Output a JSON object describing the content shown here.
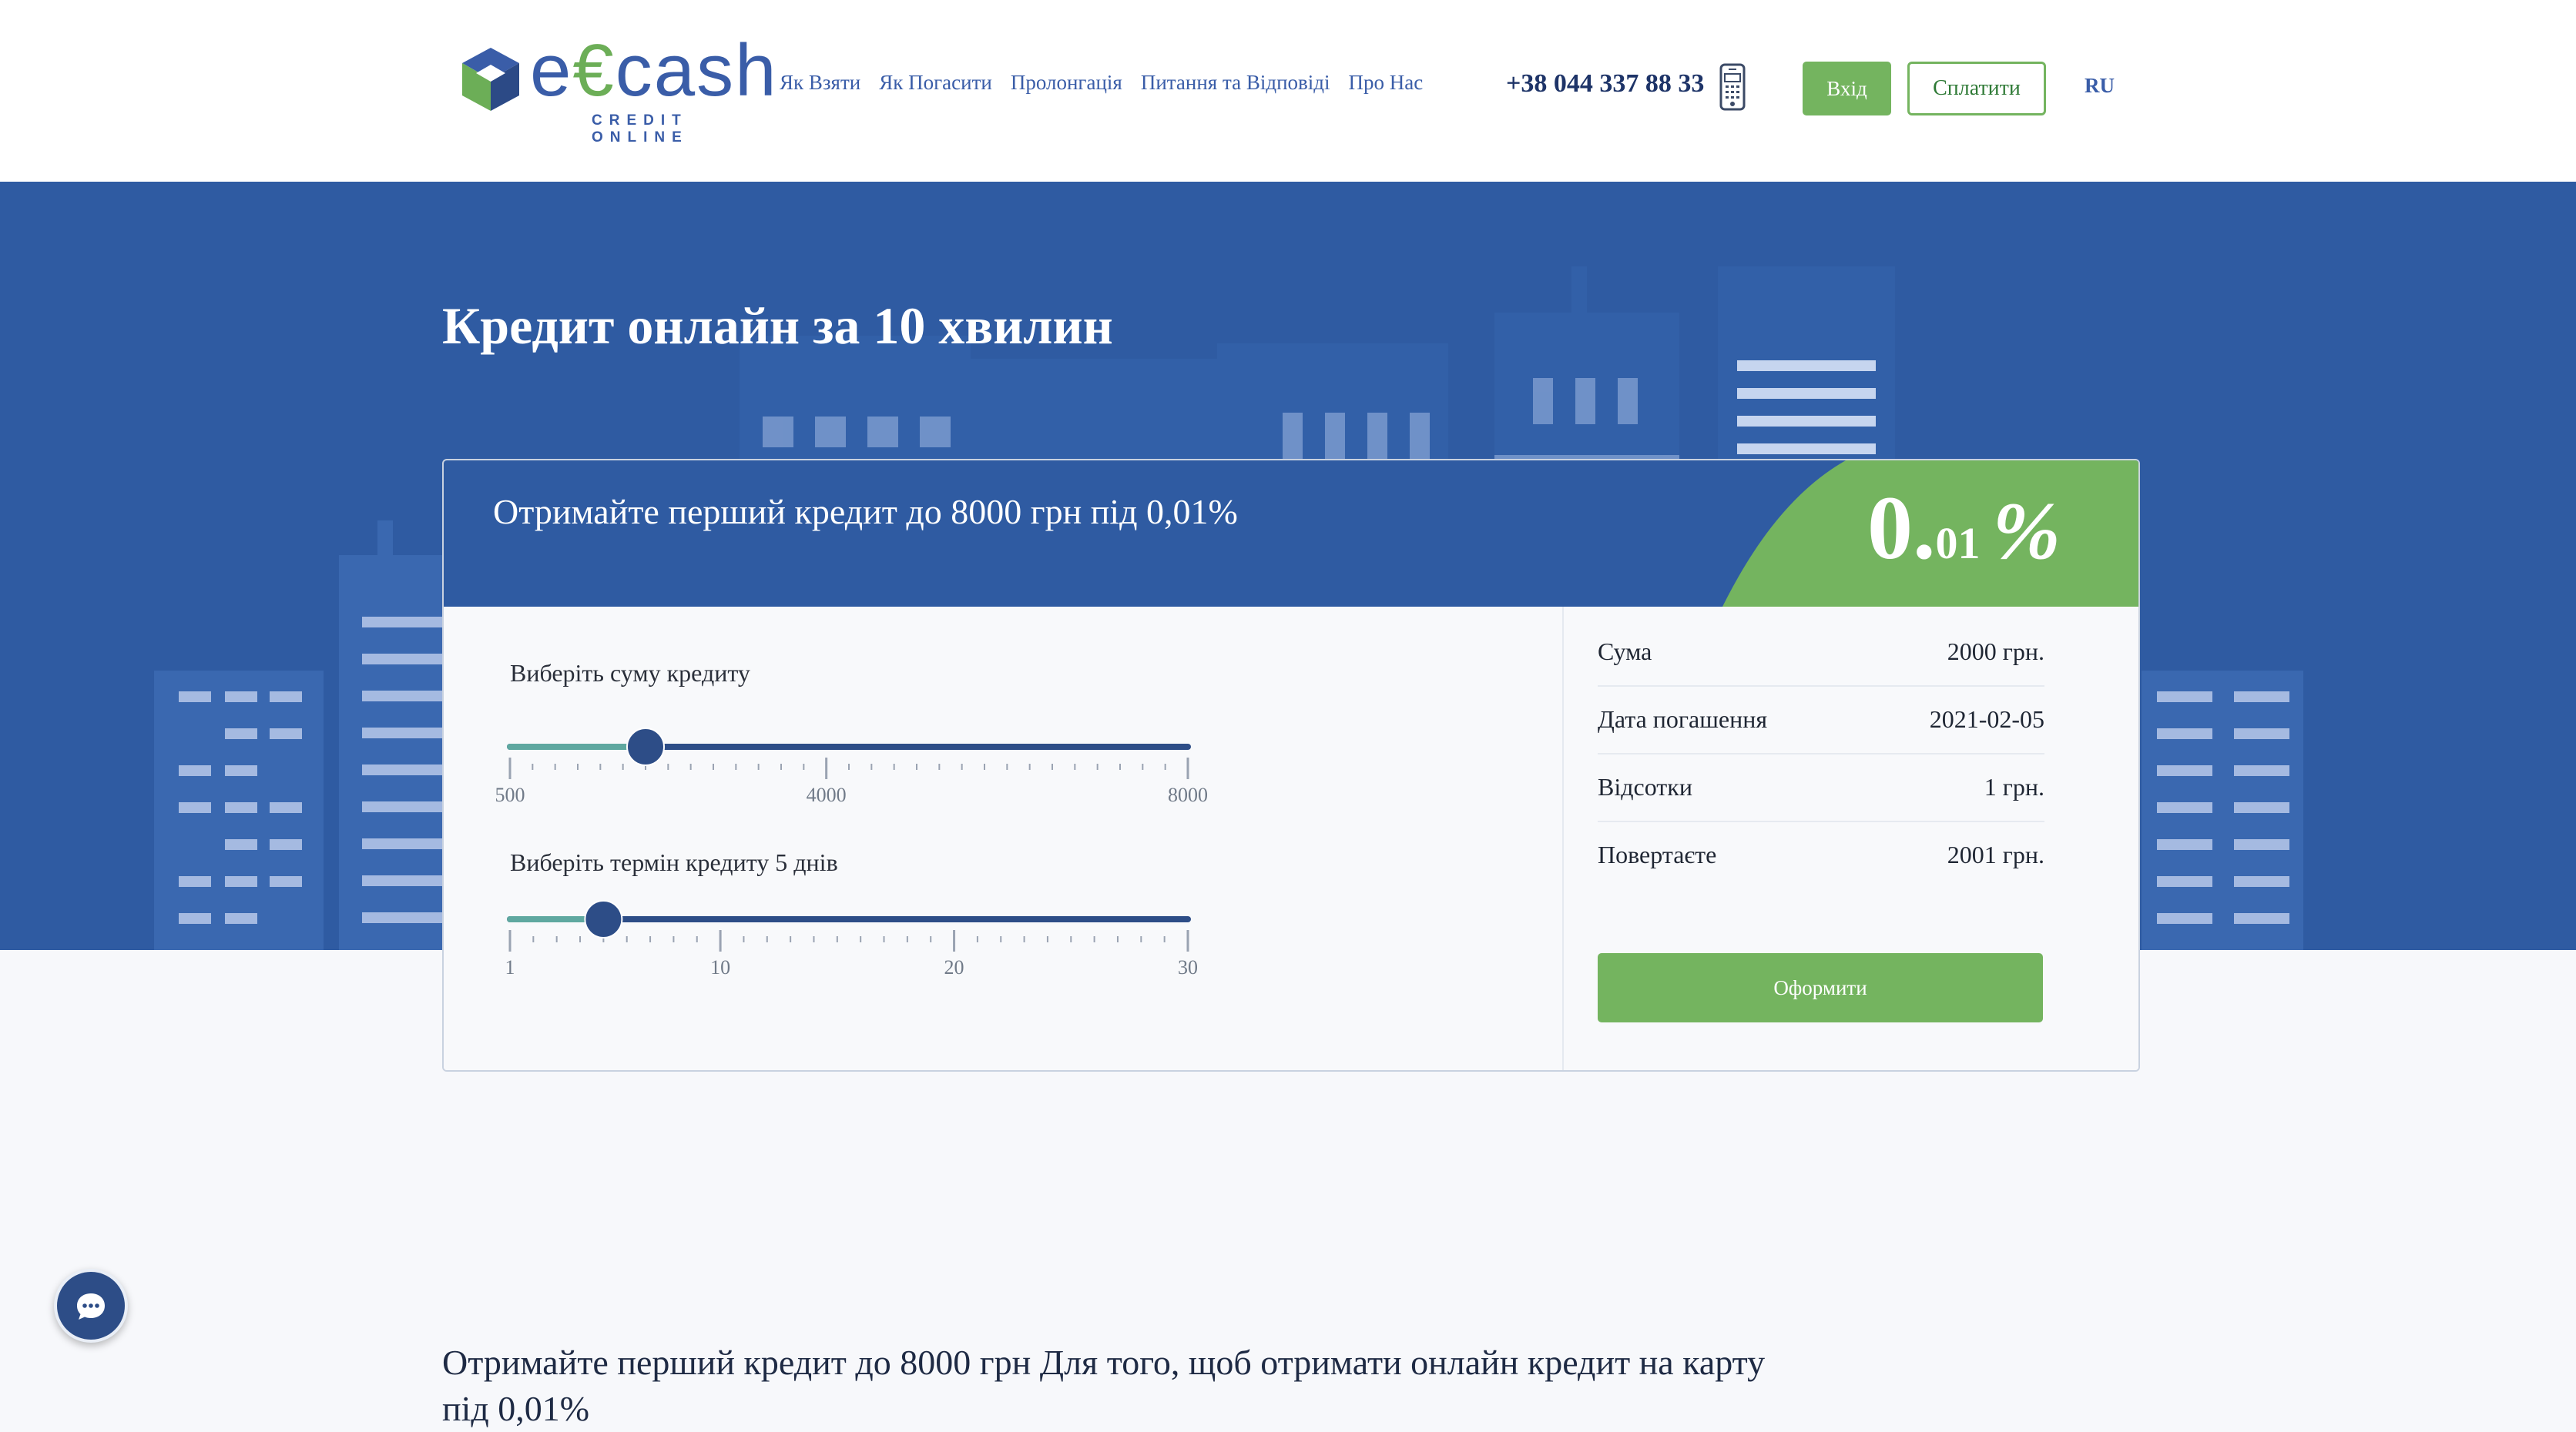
{
  "header": {
    "logo_text_pre": "e",
    "logo_text_euro": "€",
    "logo_text_post": "cash",
    "logo_subtitle": "CREDIT ONLINE",
    "nav": [
      {
        "label": "Як Взяти"
      },
      {
        "label": "Як Погасити"
      },
      {
        "label": "Пролонгація"
      },
      {
        "label": "Питання та Відповіді"
      },
      {
        "label": "Про Нас"
      }
    ],
    "phone": "+38 044 337 88 33",
    "login_label": "Вхід",
    "pay_label": "Сплатити",
    "lang": "RU"
  },
  "hero": {
    "title": "Кредит онлайн за 10 хвилин"
  },
  "calculator": {
    "headline": "Отримайте перший кредит до 8000 грн під 0,01%",
    "rate_big": "0.",
    "rate_small": "01",
    "rate_pct": "%",
    "amount": {
      "label": "Виберіть суму кредиту",
      "min": 500,
      "max": 8000,
      "value": 2000,
      "tick_labels": [
        "500",
        "4000",
        "8000"
      ]
    },
    "term": {
      "label": "Виберіть термін кредиту 5 днів",
      "min": 1,
      "max": 30,
      "value": 5,
      "tick_labels": [
        "1",
        "10",
        "20",
        "30"
      ]
    },
    "summary": [
      {
        "key": "Сума",
        "value": "2000 грн."
      },
      {
        "key": "Дата погашення",
        "value": "2021-02-05"
      },
      {
        "key": "Відсотки",
        "value": "1 грн."
      },
      {
        "key": "Повертаєте",
        "value": "2001 грн."
      }
    ],
    "apply_label": "Оформити"
  },
  "bottom": {
    "text": "Отримайте перший кредит до 8000 грн Для того, щоб отримати онлайн кредит на карту під 0,01%"
  },
  "colors": {
    "primary_blue": "#2f5ba2",
    "accent_green": "#74b45f",
    "slider_fill": "#5fa8a0",
    "slider_track": "#2d4d87"
  },
  "icons": {
    "phone": "mobile-phone-icon",
    "chat": "chat-bubble-icon",
    "logo": "cube-logo-icon"
  }
}
